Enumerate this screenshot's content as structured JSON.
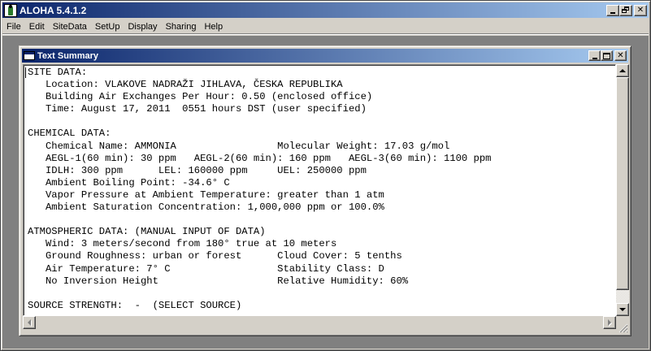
{
  "app": {
    "title": "ALOHA 5.4.1.2",
    "icon": "aloha-app-icon"
  },
  "menu": [
    {
      "label": "File"
    },
    {
      "label": "Edit"
    },
    {
      "label": "SiteData"
    },
    {
      "label": "SetUp"
    },
    {
      "label": "Display"
    },
    {
      "label": "Sharing"
    },
    {
      "label": "Help"
    }
  ],
  "summary_window": {
    "title": "Text Summary",
    "lines": [
      "SITE DATA:",
      "   Location: VLAKOVE NADRAŽI JIHLAVA, ČESKA REPUBLIKA",
      "   Building Air Exchanges Per Hour: 0.50 (enclosed office)",
      "   Time: August 17, 2011  0551 hours DST (user specified)",
      "",
      "CHEMICAL DATA:",
      "   Chemical Name: AMMONIA                 Molecular Weight: 17.03 g/mol",
      "   AEGL-1(60 min): 30 ppm   AEGL-2(60 min): 160 ppm   AEGL-3(60 min): 1100 ppm",
      "   IDLH: 300 ppm      LEL: 160000 ppm     UEL: 250000 ppm",
      "   Ambient Boiling Point: -34.6° C",
      "   Vapor Pressure at Ambient Temperature: greater than 1 atm",
      "   Ambient Saturation Concentration: 1,000,000 ppm or 100.0%",
      "",
      "ATMOSPHERIC DATA: (MANUAL INPUT OF DATA)",
      "   Wind: 3 meters/second from 180° true at 10 meters",
      "   Ground Roughness: urban or forest      Cloud Cover: 5 tenths",
      "   Air Temperature: 7° C                  Stability Class: D",
      "   No Inversion Height                    Relative Humidity: 60%",
      "",
      "SOURCE STRENGTH:  -  (SELECT SOURCE)"
    ]
  },
  "colors": {
    "titlebar_start": "#0a246a",
    "titlebar_end": "#a6caf0",
    "face": "#d4d0c8",
    "mdi_background": "#808080"
  }
}
